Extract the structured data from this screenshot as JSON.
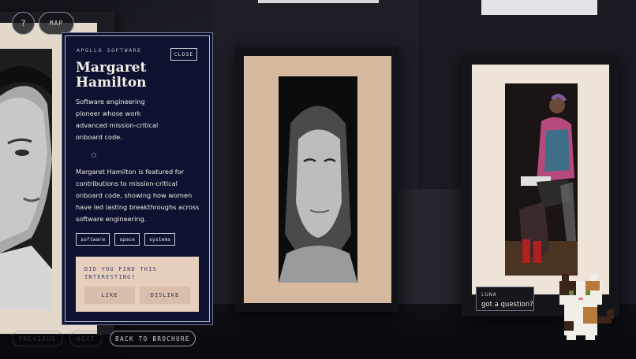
{
  "topbar": {
    "help_label": "?",
    "map_label": "MAP"
  },
  "card": {
    "kicker": "APOLLO SOFTWARE",
    "close_label": "CLOSE",
    "name_line1": "Margaret",
    "name_line2": "Hamilton",
    "summary": "Software engineering pioneer whose work advanced mission-critical onboard code.",
    "description": "Margaret Hamilton is featured for contributions to mission-critical onboard code, showing how women have led lasting breakthroughs across software engineering.",
    "tags": [
      "software",
      "space",
      "systems"
    ],
    "feedback": {
      "question": "DID YOU FIND THIS INTERESTING?",
      "like_label": "LIKE",
      "dislike_label": "DISLIKE"
    }
  },
  "nav": {
    "previous_label": "PREVIOUS",
    "next_label": "NEXT",
    "back_label": "BACK TO BROCHURE"
  },
  "chat": {
    "name": "LUNA",
    "message": "got a question?"
  },
  "colors": {
    "card_bg": "#0d1230",
    "feedback_bg": "#e6cfbd",
    "mat": "#d6b99e",
    "background": "#17181f"
  }
}
